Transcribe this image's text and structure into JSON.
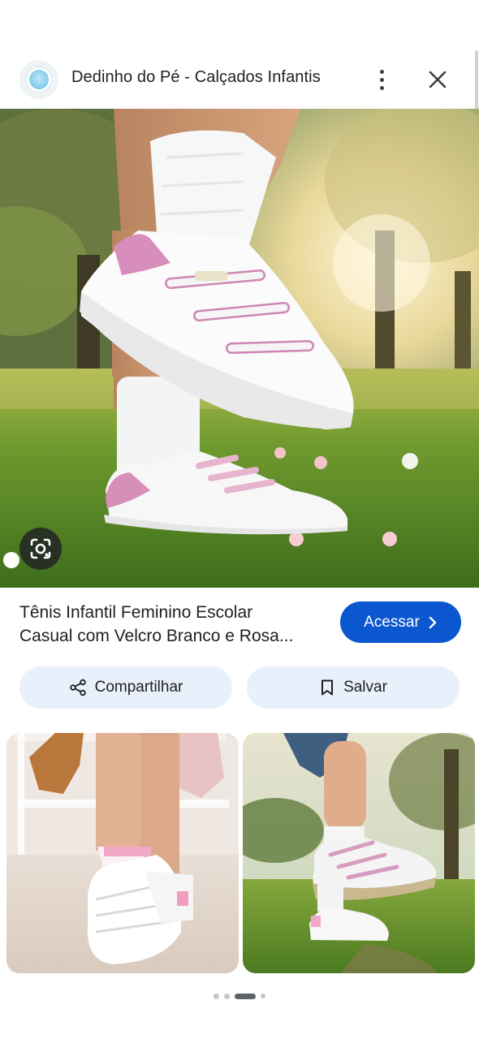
{
  "header": {
    "site_name": "Dedinho do Pé - Calçados Infantis",
    "logo_icon": "site-logo-icon",
    "menu_icon": "more-vert-icon",
    "close_icon": "close-icon"
  },
  "hero": {
    "image_icon": "product-photo",
    "lens_icon": "google-lens-icon"
  },
  "product": {
    "title_line1": "Tênis Infantil Feminino Escolar",
    "title_line2": "Casual com Velcro Branco e Rosa..."
  },
  "actions": {
    "visit_label": "Acessar",
    "share_label": "Compartilhar",
    "save_label": "Salvar"
  },
  "related": {
    "thumbnails": [
      "related-image-1",
      "related-image-2"
    ]
  },
  "pagination": {
    "dot_count": 4,
    "active_index": 2
  },
  "colors": {
    "accent": "#0b57d0",
    "pill_bg": "#e8f0fb",
    "text": "#202124"
  }
}
